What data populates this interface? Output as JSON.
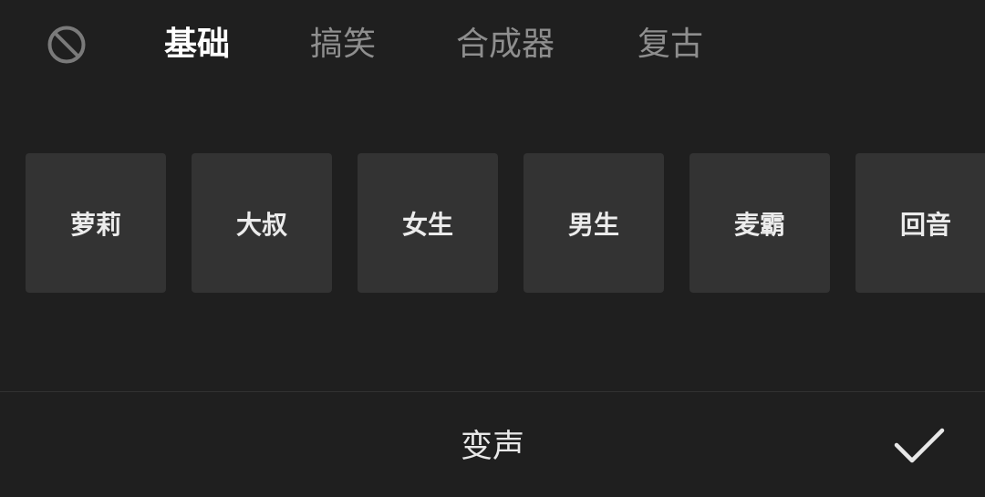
{
  "tabs": {
    "none_icon": "no-effect-icon",
    "items": [
      {
        "label": "基础",
        "active": true
      },
      {
        "label": "搞笑",
        "active": false
      },
      {
        "label": "合成器",
        "active": false
      },
      {
        "label": "复古",
        "active": false
      }
    ]
  },
  "effects": [
    {
      "label": "萝莉"
    },
    {
      "label": "大叔"
    },
    {
      "label": "女生"
    },
    {
      "label": "男生"
    },
    {
      "label": "麦霸"
    },
    {
      "label": "回音"
    }
  ],
  "bottom_bar": {
    "title": "变声",
    "confirm_icon": "checkmark-icon"
  },
  "colors": {
    "background": "#1f1f1f",
    "tile": "#333333",
    "active_tab": "#ffffff",
    "inactive_tab": "#8e8e8e"
  }
}
